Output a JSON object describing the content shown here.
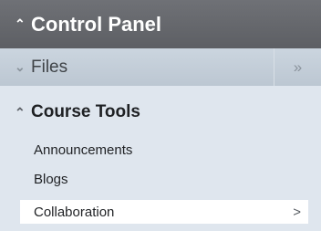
{
  "control_panel": {
    "title": "Control Panel",
    "chevron": "⌃"
  },
  "files": {
    "label": "Files",
    "chevron": "⌄",
    "expand": "»"
  },
  "course_tools": {
    "title": "Course Tools",
    "chevron": "⌃",
    "items": [
      {
        "label": "Announcements"
      },
      {
        "label": "Blogs"
      },
      {
        "label": "Collaboration",
        "arrow": ">"
      }
    ]
  }
}
